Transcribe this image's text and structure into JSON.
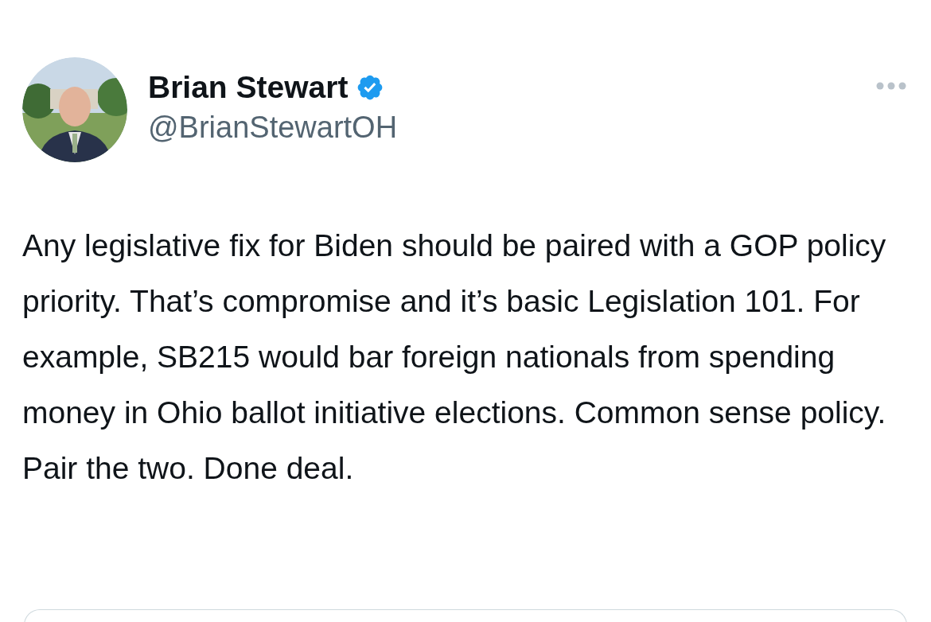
{
  "author": {
    "name": "Brian Stewart",
    "handle": "@BrianStewartOH",
    "verified": true
  },
  "tweet": {
    "text": "Any legislative fix for Biden should be paired with a GOP policy priority. That’s compromise and it’s basic Legislation 101. For example, SB215 would bar foreign nationals from spending money in Ohio ballot initiative elections. Common sense policy. Pair the two. Done deal."
  }
}
